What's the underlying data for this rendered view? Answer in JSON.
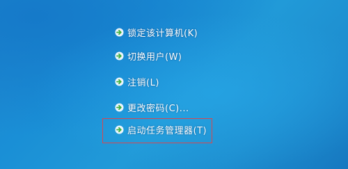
{
  "menu": {
    "items": [
      {
        "label": "锁定该计算机(K)",
        "icon": "green-arrow-icon"
      },
      {
        "label": "切换用户(W)",
        "icon": "green-arrow-icon"
      },
      {
        "label": "注销(L)",
        "icon": "green-arrow-icon"
      },
      {
        "label": "更改密码(C)...",
        "icon": "green-arrow-icon"
      },
      {
        "label": "启动任务管理器(T)",
        "icon": "green-arrow-icon"
      }
    ]
  },
  "colors": {
    "background": "#1f8fd3",
    "text": "#ffffff",
    "arrow": "#5cc94a",
    "highlight_border": "#d8474f"
  }
}
